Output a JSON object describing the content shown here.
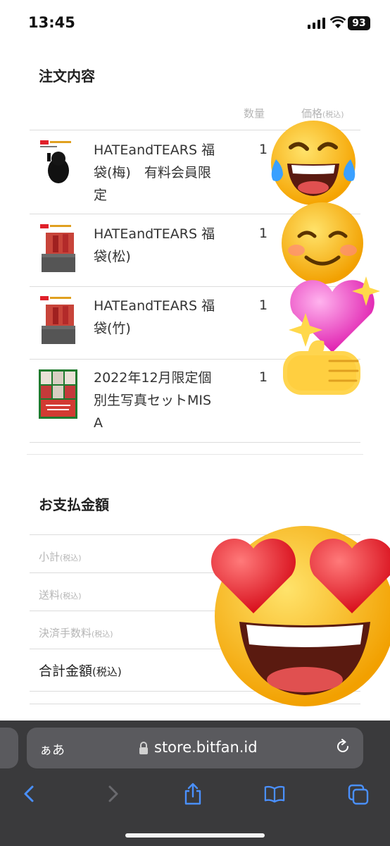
{
  "status": {
    "time": "13:45",
    "battery": "93"
  },
  "order": {
    "title": "注文内容",
    "col_qty": "数量",
    "col_price": "価格",
    "col_price_note": "(税込)",
    "items": [
      {
        "name": "HATEandTEARS 福袋(梅)　有料会員限定",
        "qty": "1"
      },
      {
        "name": "HATEandTEARS 福袋(松)",
        "qty": "1"
      },
      {
        "name": "HATEandTEARS 福袋(竹)",
        "qty": "1"
      },
      {
        "name": "2022年12月限定個別生写真セットMISA",
        "qty": "1"
      }
    ]
  },
  "payment": {
    "title": "お支払金額",
    "subtotal": "小計",
    "shipping": "送料",
    "fee": "決済手数料",
    "tax_note": "(税込)",
    "total": "合計金額"
  },
  "browser": {
    "text_size_button": "ぁあ",
    "domain": "store.bitfan.id"
  },
  "icons": [
    "signal-icon",
    "wifi-icon",
    "lock-icon",
    "reload-icon",
    "back-icon",
    "forward-icon",
    "share-icon",
    "bookmarks-icon",
    "tabs-icon"
  ]
}
